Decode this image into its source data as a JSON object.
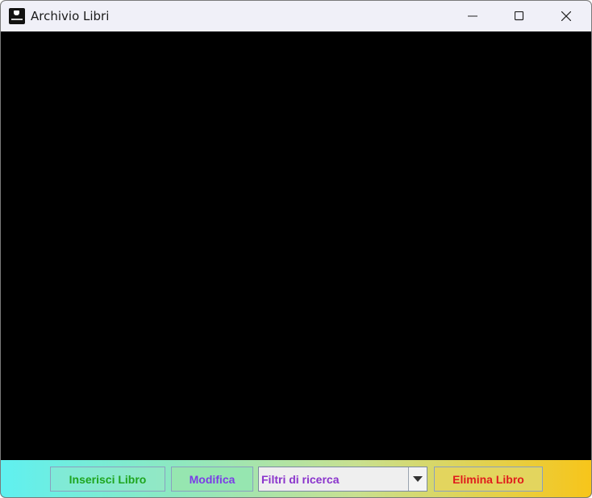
{
  "window": {
    "title": "Archivio Libri"
  },
  "titlebar": {
    "icons": [
      "app-icon",
      "minimize-icon",
      "maximize-icon",
      "close-icon"
    ]
  },
  "toolbar": {
    "insert_label": "Inserisci Libro",
    "modify_label": "Modifica",
    "filter_selected": "Filtri di ricerca",
    "delete_label": "Elimina Libro"
  },
  "colors": {
    "content_background": "#000000",
    "insert_text": "#1ea51e",
    "modify_text": "#7a3de6",
    "filter_text": "#8a33cc",
    "delete_text": "#e01c1c",
    "bar_gradient_start": "#5ff0f0",
    "bar_gradient_end": "#f7c51a"
  }
}
